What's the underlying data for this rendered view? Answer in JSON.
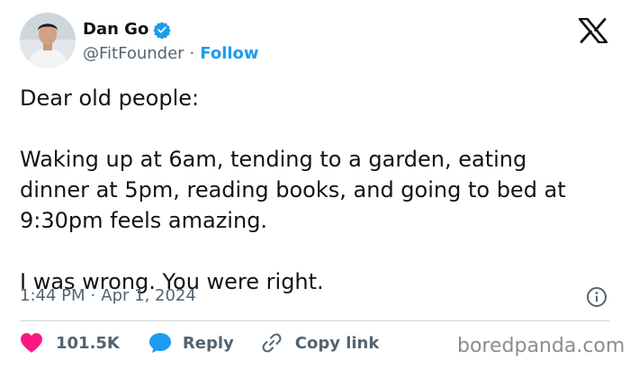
{
  "author": {
    "name": "Dan Go",
    "handle": "@FitFounder",
    "separator": "·",
    "follow_label": "Follow"
  },
  "tweet": {
    "text": "Dear old people:\n\nWaking up at 6am, tending to a garden, eating\ndinner at 5pm, reading books, and going to bed at\n9:30pm feels amazing.\n\nI was wrong. You were right.",
    "time": "1:44 PM",
    "separator": "·",
    "date": "Apr 1, 2024"
  },
  "actions": {
    "like_count": "101.5K",
    "reply_label": "Reply",
    "copy_link_label": "Copy link"
  },
  "watermark": "boredpanda.com",
  "colors": {
    "accent": "#1d9bf0",
    "like": "#f91880",
    "text": "#0f1419",
    "secondary": "#536471"
  },
  "icons": [
    "verified-badge-icon",
    "x-logo-icon",
    "info-icon",
    "heart-icon",
    "reply-bubble-icon",
    "link-icon"
  ]
}
